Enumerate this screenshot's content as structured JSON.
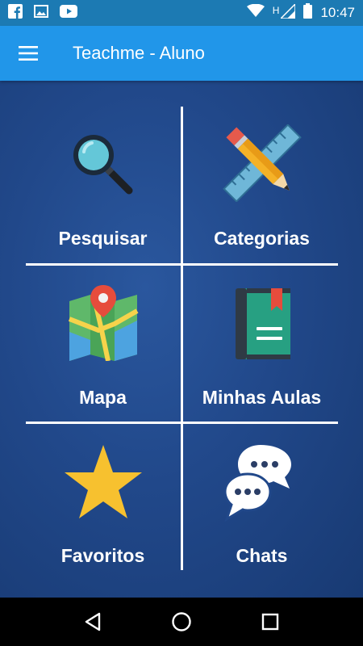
{
  "status_bar": {
    "time": "10:47",
    "network_letter": "H",
    "icons": [
      "facebook-icon",
      "image-icon",
      "youtube-icon",
      "wifi-icon",
      "signal-icon",
      "battery-icon"
    ]
  },
  "app_bar": {
    "title": "Teachme - Aluno",
    "menu_icon": "hamburger-menu-icon",
    "color": "#2196e9"
  },
  "tiles": [
    {
      "label": "Pesquisar",
      "icon": "magnifier-icon"
    },
    {
      "label": "Categorias",
      "icon": "ruler-pencil-icon"
    },
    {
      "label": "Mapa",
      "icon": "map-icon"
    },
    {
      "label": "Minhas Aulas",
      "icon": "book-icon"
    },
    {
      "label": "Favoritos",
      "icon": "star-icon"
    },
    {
      "label": "Chats",
      "icon": "chat-bubbles-icon"
    }
  ],
  "nav_bar": {
    "icons": [
      "back-icon",
      "home-icon",
      "recents-icon"
    ]
  },
  "colors": {
    "background": "#21488a",
    "star": "#f7c12f",
    "status_bar": "#1c7ab3"
  }
}
